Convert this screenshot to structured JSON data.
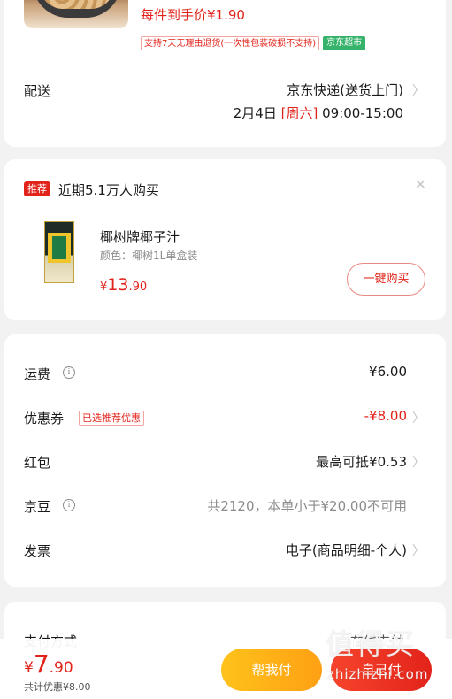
{
  "top_item": {
    "unit_price": "每件到手价¥1.90",
    "tags": [
      "支持7天无理由退货(一次性包装破损不支持)",
      "京东超市"
    ]
  },
  "delivery": {
    "label": "配送",
    "method": "京东快递(送货上门)",
    "date": "2月4日",
    "weekday": "[周六]",
    "time_range": "09:00-15:00"
  },
  "recommend": {
    "badge": "推荐",
    "title": "近期5.1万人购买",
    "close_icon": "close-icon",
    "product_name": "椰树牌椰子汁",
    "spec": "颜色：椰树1L单盒装",
    "price_symbol": "¥",
    "price_int": "13",
    "price_dec": ".90",
    "buy_label": "一键购买"
  },
  "fees": {
    "shipping_label": "运费",
    "shipping_value": "¥6.00",
    "coupon_label": "优惠券",
    "coupon_tag": "已选推荐优惠",
    "coupon_value": "-¥8.00",
    "redpacket_label": "红包",
    "redpacket_value": "最高可抵¥0.53",
    "jingdou_label": "京豆",
    "jingdou_value": "共2120，本单小于¥20.00不可用",
    "invoice_label": "发票",
    "invoice_value": "电子(商品明细-个人)"
  },
  "payment": {
    "label": "支付方式",
    "value": "在线支付"
  },
  "bottom_bar": {
    "price_symbol": "¥",
    "price_int": "7",
    "price_dec": ".90",
    "saving": "共计优惠¥8.00",
    "help_pay_label": "帮我付",
    "self_pay_label": "自己付"
  },
  "watermark": {
    "logo": "值得买",
    "text": "zhizhizhi.com"
  },
  "colors": {
    "accent": "#e2231a",
    "green_tag": "#35b36a",
    "help_btn": "#ffa014"
  }
}
